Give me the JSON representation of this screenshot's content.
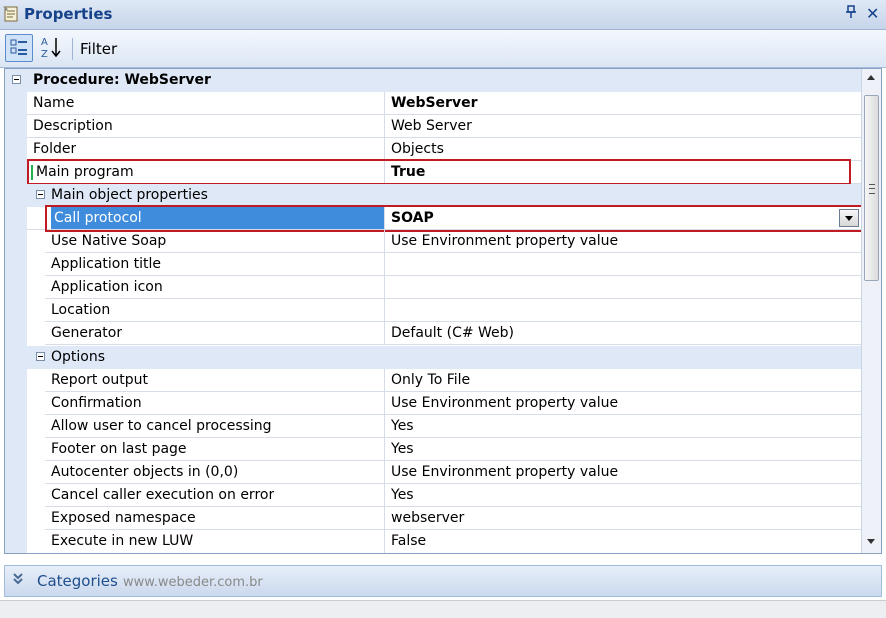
{
  "window": {
    "title": "Properties",
    "pin_icon": "pin-icon",
    "close_label": "✕"
  },
  "toolbar": {
    "categorized_icon": "categorized-view-icon",
    "sort_icon": "sort-az-icon",
    "filter_label": "Filter"
  },
  "grid": {
    "root": {
      "label": "Procedure: WebServer"
    },
    "rows": [
      {
        "name": "Name",
        "value": "WebServer",
        "bold": true
      },
      {
        "name": "Description",
        "value": "Web Server"
      },
      {
        "name": "Folder",
        "value": "Objects"
      },
      {
        "name": "Main program",
        "value": "True",
        "bold": true
      }
    ],
    "group1": {
      "label": "Main object properties",
      "rows": [
        {
          "name": "Call protocol",
          "value": "SOAP",
          "bold": true
        },
        {
          "name": "Use Native Soap",
          "value": "Use Environment property value"
        },
        {
          "name": "Application title",
          "value": ""
        },
        {
          "name": "Application icon",
          "value": ""
        },
        {
          "name": "Location",
          "value": ""
        },
        {
          "name": "Generator",
          "value": "Default (C# Web)"
        }
      ]
    },
    "group2": {
      "label": "Options",
      "rows": [
        {
          "name": "Report output",
          "value": "Only To File"
        },
        {
          "name": "Confirmation",
          "value": "Use Environment property value"
        },
        {
          "name": "Allow user to cancel processing",
          "value": "Yes"
        },
        {
          "name": "Footer on last page",
          "value": "Yes"
        },
        {
          "name": "Autocenter objects in (0,0)",
          "value": "Use Environment property value"
        },
        {
          "name": "Cancel caller execution on error",
          "value": "Yes"
        },
        {
          "name": "Exposed namespace",
          "value": "webserver"
        },
        {
          "name": "Execute in new LUW",
          "value": "False"
        }
      ]
    }
  },
  "bottom": {
    "categories_label": "Categories",
    "watermark": "www.webeder.com.br"
  },
  "colors": {
    "selection": "#3e8cdb",
    "highlight_border": "#c01a22",
    "category_bg": "#dfe8f6"
  }
}
